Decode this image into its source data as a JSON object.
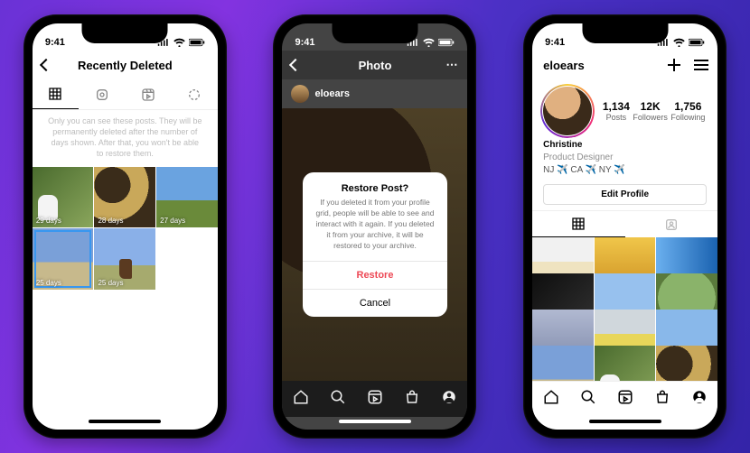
{
  "status": {
    "time": "9:41"
  },
  "phone1": {
    "title": "Recently Deleted",
    "hint": "Only you can see these posts. They will be permanently deleted after the number of days shown. After that, you won't be able to restore them.",
    "thumbs": [
      {
        "days": "29 days"
      },
      {
        "days": "28 days"
      },
      {
        "days": "27 days"
      },
      {
        "days": "25 days"
      },
      {
        "days": "25 days"
      }
    ]
  },
  "phone2": {
    "title": "Photo",
    "author": "eloears",
    "modal": {
      "title": "Restore Post?",
      "body": "If you deleted it from your profile grid, people will be able to see and interact with it again. If you deleted it from your archive, it will be restored to your archive.",
      "restore": "Restore",
      "cancel": "Cancel"
    }
  },
  "phone3": {
    "username": "eloears",
    "stats": {
      "posts": {
        "num": "1,134",
        "label": "Posts"
      },
      "followers": {
        "num": "12K",
        "label": "Followers"
      },
      "following": {
        "num": "1,756",
        "label": "Following"
      }
    },
    "bio": {
      "name": "Christine",
      "title": "Product Designer",
      "location": "NJ ✈️ CA ✈️ NY ✈️"
    },
    "edit": "Edit Profile"
  }
}
